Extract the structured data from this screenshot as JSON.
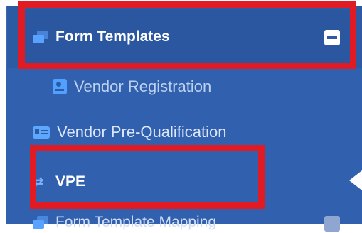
{
  "sidebar": {
    "group": {
      "label": "Form Templates",
      "icon": "layers-icon",
      "toggle": "collapse-minus"
    },
    "items": [
      {
        "label": "Vendor Registration",
        "icon": "vcard-icon"
      },
      {
        "label": "Vendor Pre-Qualification",
        "icon": "id-card-icon"
      },
      {
        "label": "VPE",
        "icon": "exchange-icon",
        "active": true
      }
    ],
    "next_group": {
      "label": "Form Template Mapping",
      "icon": "layers-icon",
      "toggle": "expand-plus"
    }
  },
  "colors": {
    "sidebar_bg": "#2c5aa3",
    "highlight": "#e01b23",
    "icon_blue": "#5aa2ff"
  }
}
